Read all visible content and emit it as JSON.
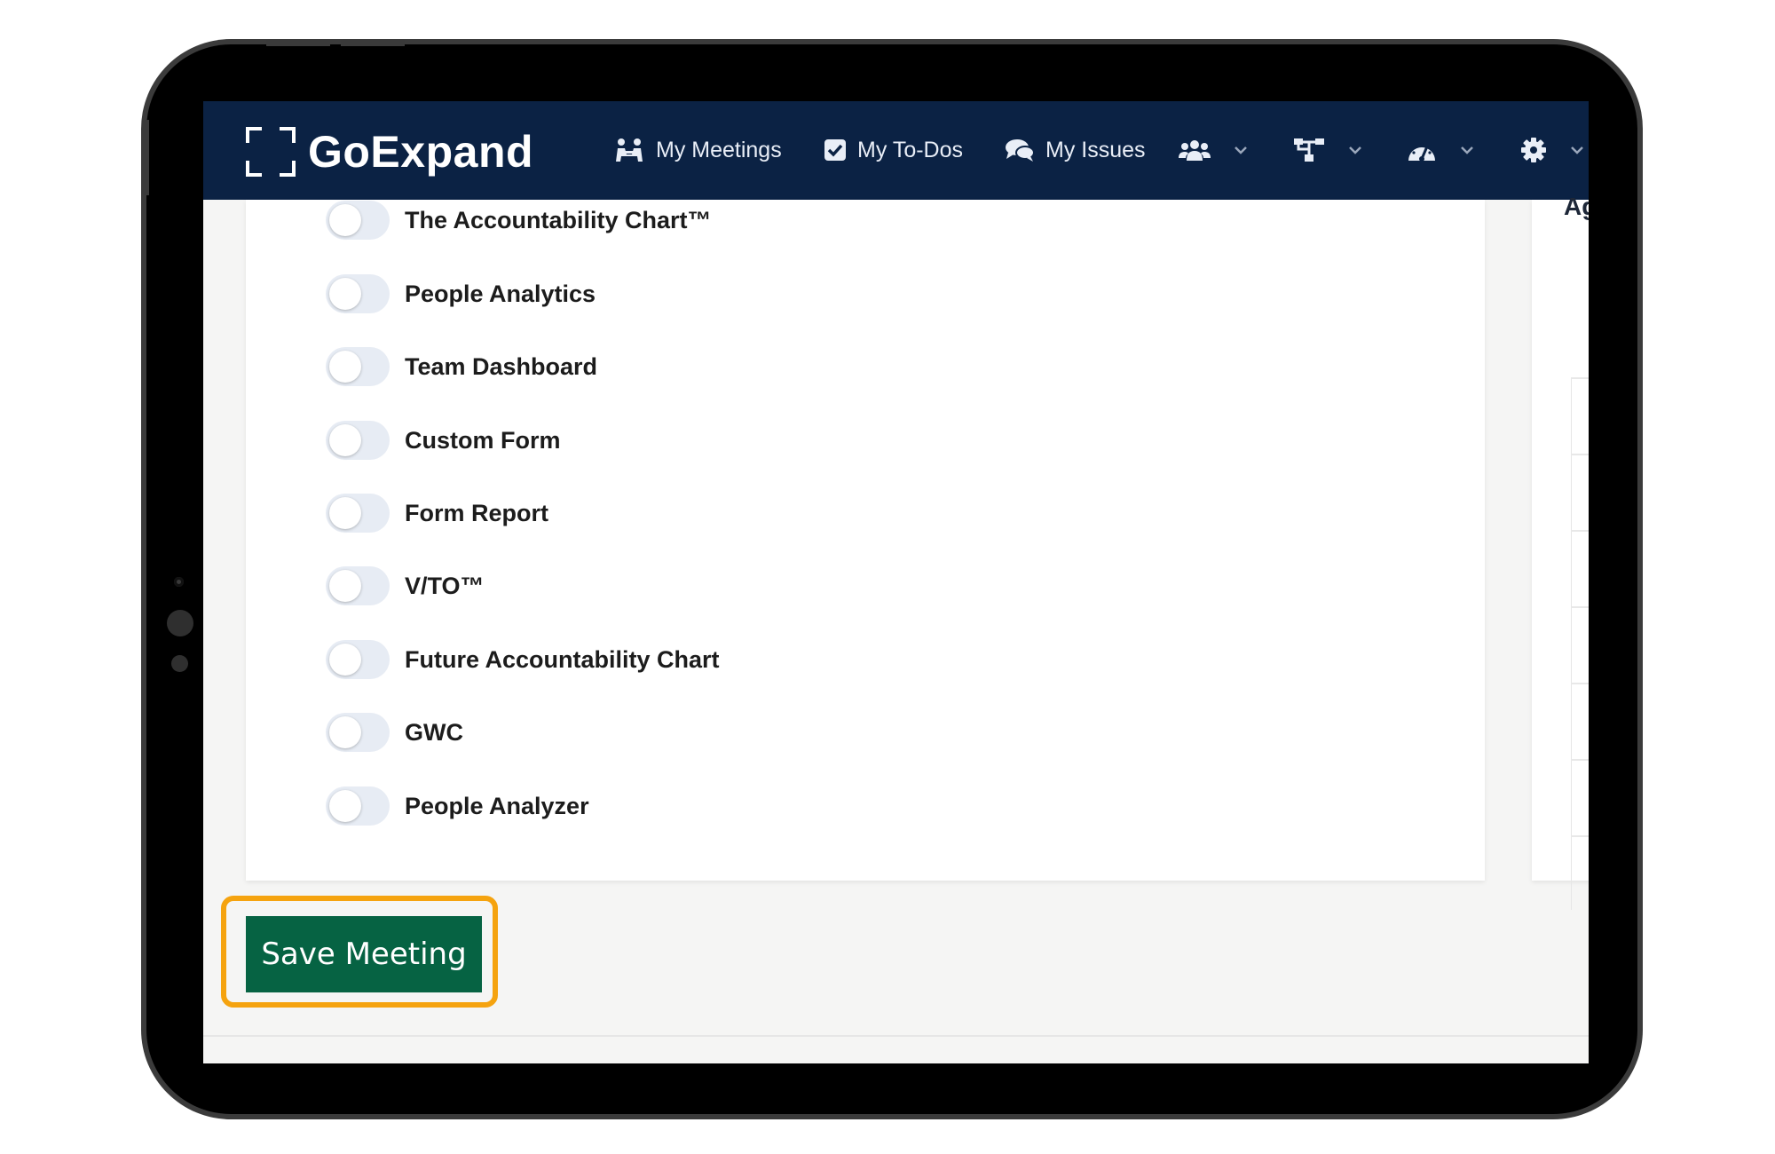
{
  "nav": {
    "logo_text": "GoExpand",
    "items": [
      {
        "label": "My Meetings",
        "icon": "meetings-icon"
      },
      {
        "label": "My To-Dos",
        "icon": "checkbox-icon"
      },
      {
        "label": "My Issues",
        "icon": "chat-icon"
      }
    ],
    "dropdowns": [
      "people-icon",
      "org-chart-icon",
      "dashboard-icon",
      "gear-icon"
    ]
  },
  "right_card": {
    "heading": "Ag"
  },
  "toggles": [
    {
      "label": "The Accountability Chart™",
      "checked": false
    },
    {
      "label": "People Analytics",
      "checked": false
    },
    {
      "label": "Team Dashboard",
      "checked": false
    },
    {
      "label": "Custom Form",
      "checked": false
    },
    {
      "label": "Form Report",
      "checked": false
    },
    {
      "label": "V/TO™",
      "checked": false
    },
    {
      "label": "Future Accountability Chart",
      "checked": false
    },
    {
      "label": "GWC",
      "checked": false
    },
    {
      "label": "People Analyzer",
      "checked": false
    }
  ],
  "actions": {
    "save_label": "Save Meeting"
  },
  "colors": {
    "nav_bg": "#0b2244",
    "save_bg": "#066343",
    "highlight": "#f5a30f"
  }
}
